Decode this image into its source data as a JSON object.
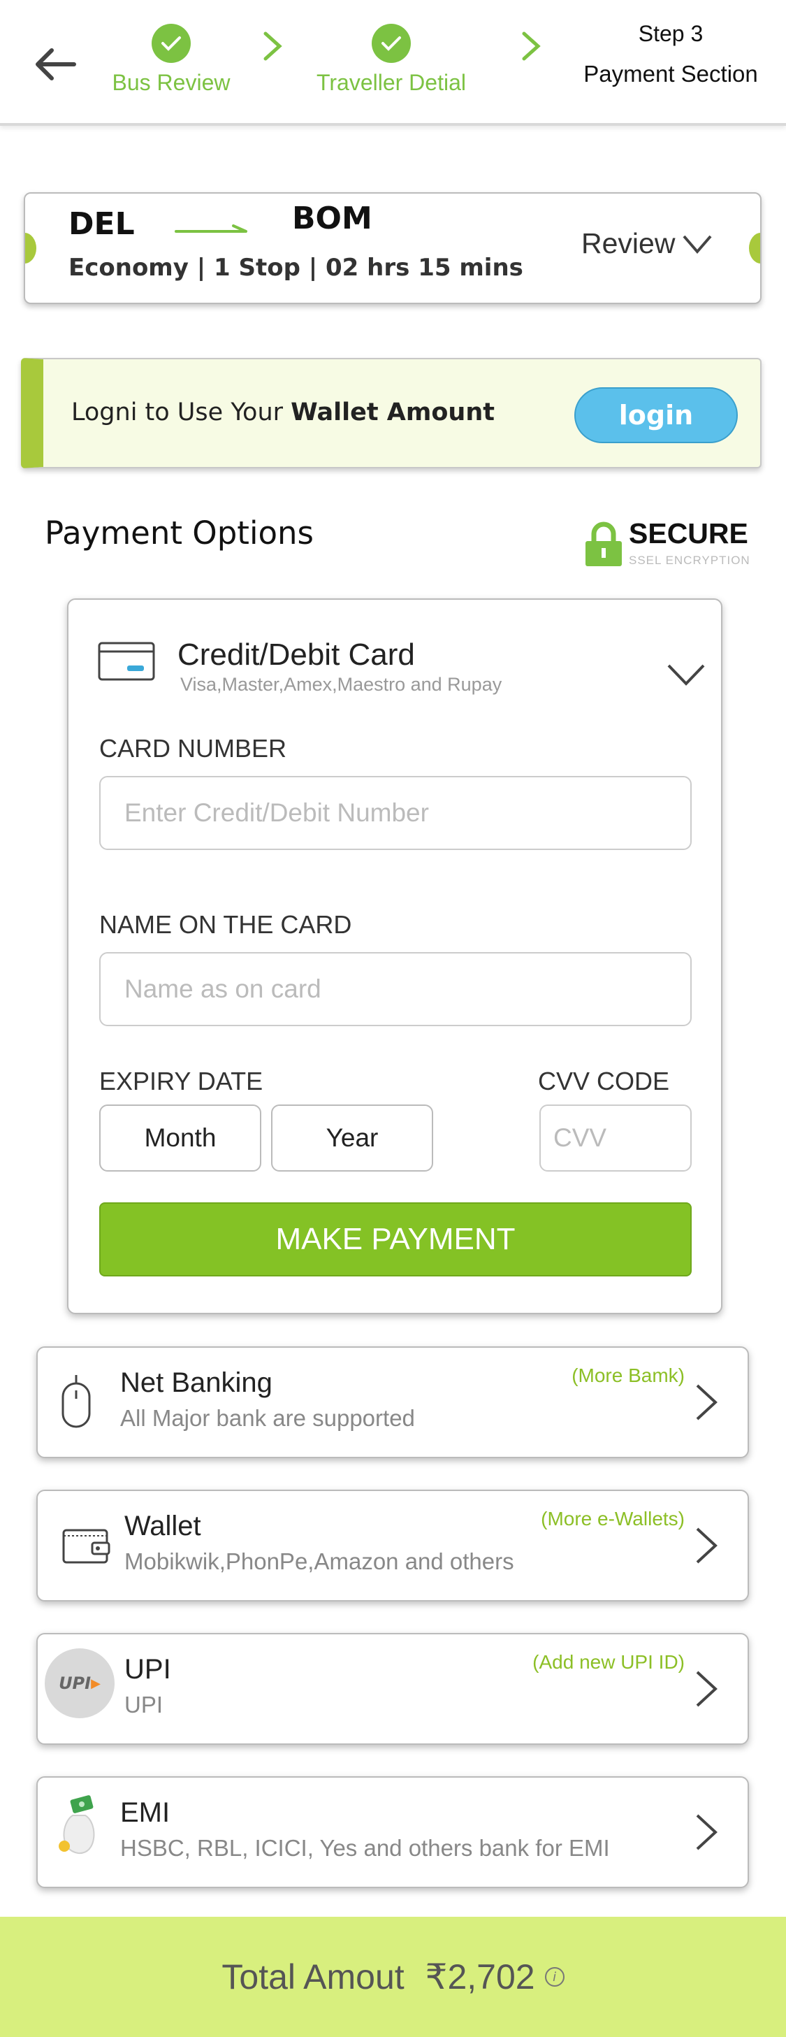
{
  "header": {
    "steps": [
      {
        "label": "Bus Review"
      },
      {
        "label": "Traveller Detial"
      }
    ],
    "current_step_number": "Step 3",
    "current_step_label": "Payment Section",
    "accent_color": "#7cc242"
  },
  "route": {
    "from": "DEL",
    "to": "BOM",
    "meta": "Economy | 1 Stop | 02 hrs 15 mins",
    "review_label": "Review"
  },
  "wallet_banner": {
    "text_prefix": "Logni to Use Your ",
    "text_bold": "Wallet Amount",
    "login_label": "login"
  },
  "payment_options": {
    "title": "Payment Options",
    "secure_title": "SECURE",
    "secure_sub": "SSEL ENCRYPTION"
  },
  "card": {
    "title": "Credit/Debit Card",
    "subtitle": "Visa,Master,Amex,Maestro and Rupay",
    "card_number_label": "CARD NUMBER",
    "card_number_placeholder": "Enter Credit/Debit Number",
    "name_label": "NAME ON THE CARD",
    "name_placeholder": "Name as on card",
    "expiry_label": "EXPIRY DATE",
    "month_label": "Month",
    "year_label": "Year",
    "cvv_label": "CVV CODE",
    "cvv_placeholder": "CVV",
    "pay_button": "MAKE PAYMENT"
  },
  "options": [
    {
      "title": "Net Banking",
      "sub": "All Major bank are supported",
      "more": "(More Bamk)",
      "icon": "mouse-icon"
    },
    {
      "title": "Wallet",
      "sub": "Mobikwik,PhonPe,Amazon and others",
      "more": "(More e-Wallets)",
      "icon": "wallet-icon"
    },
    {
      "title": "UPI",
      "sub": "UPI",
      "more": "(Add new UPI ID)",
      "icon": "upi-icon",
      "icon_text": "UPI"
    },
    {
      "title": "EMI",
      "sub": "HSBC, RBL, ICICI, Yes and others bank for EMI",
      "more": "",
      "icon": "money-bag-icon"
    }
  ],
  "footer": {
    "label": "Total Amout",
    "amount": "₹2,702",
    "info_glyph": "i"
  }
}
